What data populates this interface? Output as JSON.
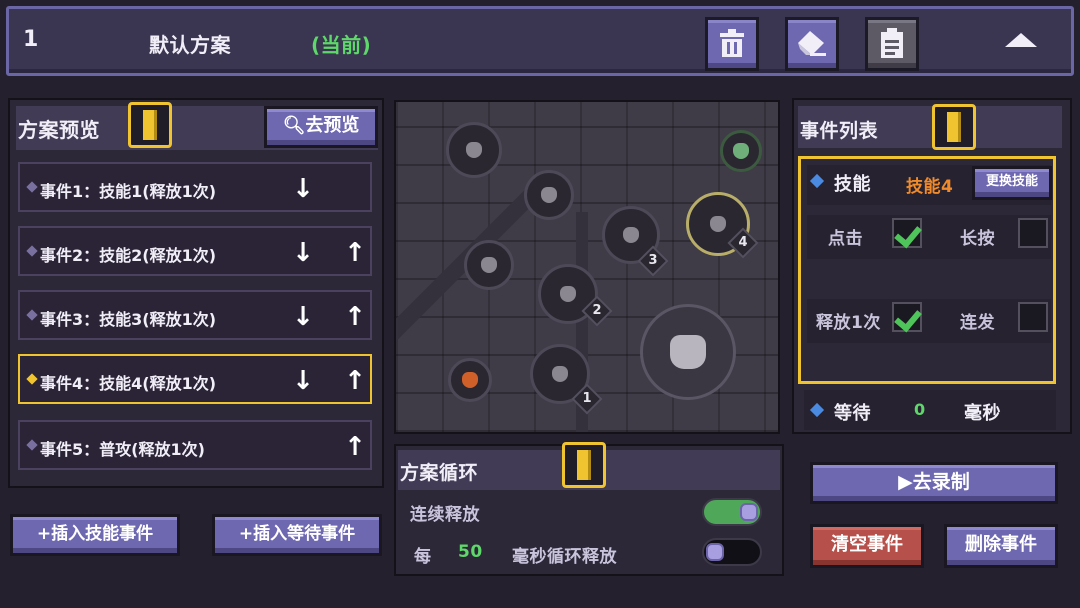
{
  "header": {
    "scheme_number": "1",
    "scheme_name": "默认方案",
    "current_tag": "(当前)"
  },
  "preview_panel": {
    "title": "方案预览",
    "preview_button": "去预览",
    "events": [
      {
        "label": "事件1：技能1(释放1次)",
        "down": true,
        "up": false,
        "selected": false
      },
      {
        "label": "事件2：技能2(释放1次)",
        "down": true,
        "up": true,
        "selected": false
      },
      {
        "label": "事件3：技能3(释放1次)",
        "down": true,
        "up": true,
        "selected": false
      },
      {
        "label": "事件4：技能4(释放1次)",
        "down": true,
        "up": true,
        "selected": true
      },
      {
        "label": "事件5：普攻(释放1次)",
        "down": false,
        "up": true,
        "selected": false
      }
    ],
    "insert_skill_button": "插入技能事件",
    "insert_wait_button": "插入等待事件"
  },
  "map": {
    "skill_badges": [
      "1",
      "2",
      "3",
      "4"
    ]
  },
  "event_list": {
    "title": "事件列表",
    "skill_label": "技能",
    "skill_value": "技能4",
    "change_skill_button": "更换技能",
    "tap_label": "点击",
    "tap_checked": true,
    "hold_label": "长按",
    "hold_checked": false,
    "release_once_label": "释放1次",
    "release_once_checked": true,
    "combo_label": "连发",
    "combo_checked": false,
    "wait_label": "等待",
    "wait_value": "0",
    "wait_unit": "毫秒"
  },
  "loop_panel": {
    "title": "方案循环",
    "continuous_label": "连续释放",
    "continuous_on": true,
    "every_label": "每",
    "interval_value": "50",
    "interval_suffix": "毫秒循环释放",
    "loop_on": false
  },
  "actions": {
    "record_button": "去录制",
    "clear_button": "清空事件",
    "delete_button": "删除事件"
  },
  "colors": {
    "accent_purple": "#6e68b0",
    "highlight_gold": "#f0c430",
    "current_green": "#5ed86a",
    "skill_orange": "#f08a2a",
    "danger_red": "#b5504a"
  }
}
